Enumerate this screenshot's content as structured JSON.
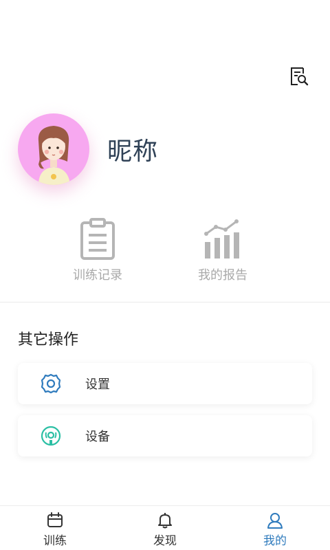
{
  "profile": {
    "nickname": "昵称",
    "avatar_icon": "girl-avatar-icon"
  },
  "header": {
    "search_icon": "record-search-icon"
  },
  "quick_actions": [
    {
      "label": "训练记录",
      "icon": "clipboard-icon"
    },
    {
      "label": "我的报告",
      "icon": "bar-chart-icon"
    }
  ],
  "other_ops": {
    "title": "其它操作",
    "items": [
      {
        "label": "设置",
        "icon": "gear-icon"
      },
      {
        "label": "设备",
        "icon": "device-signal-icon"
      }
    ]
  },
  "tabbar": {
    "items": [
      {
        "label": "训练",
        "icon": "calendar-icon"
      },
      {
        "label": "发现",
        "icon": "bell-icon"
      },
      {
        "label": "我的",
        "icon": "person-icon"
      }
    ],
    "active_index": 2
  },
  "colors": {
    "accent": "#2f7bbd",
    "teal": "#2bbfa4",
    "avatar_bg": "#f7a8f0",
    "muted": "#a9a9a9"
  }
}
